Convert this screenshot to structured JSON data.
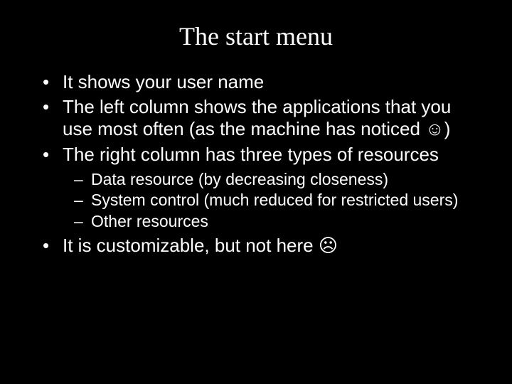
{
  "slide": {
    "title": "The start menu",
    "bullets": [
      {
        "text": "It shows your user name"
      },
      {
        "text": "The left column shows the applications that you use most often (as the machine has noticed ☺)"
      },
      {
        "text": "The right column has three types of resources",
        "sub": [
          "Data resource (by decreasing closeness)",
          "System control (much reduced for restricted users)",
          "Other resources"
        ]
      },
      {
        "text": "It is customizable, but not here ☹"
      }
    ]
  }
}
